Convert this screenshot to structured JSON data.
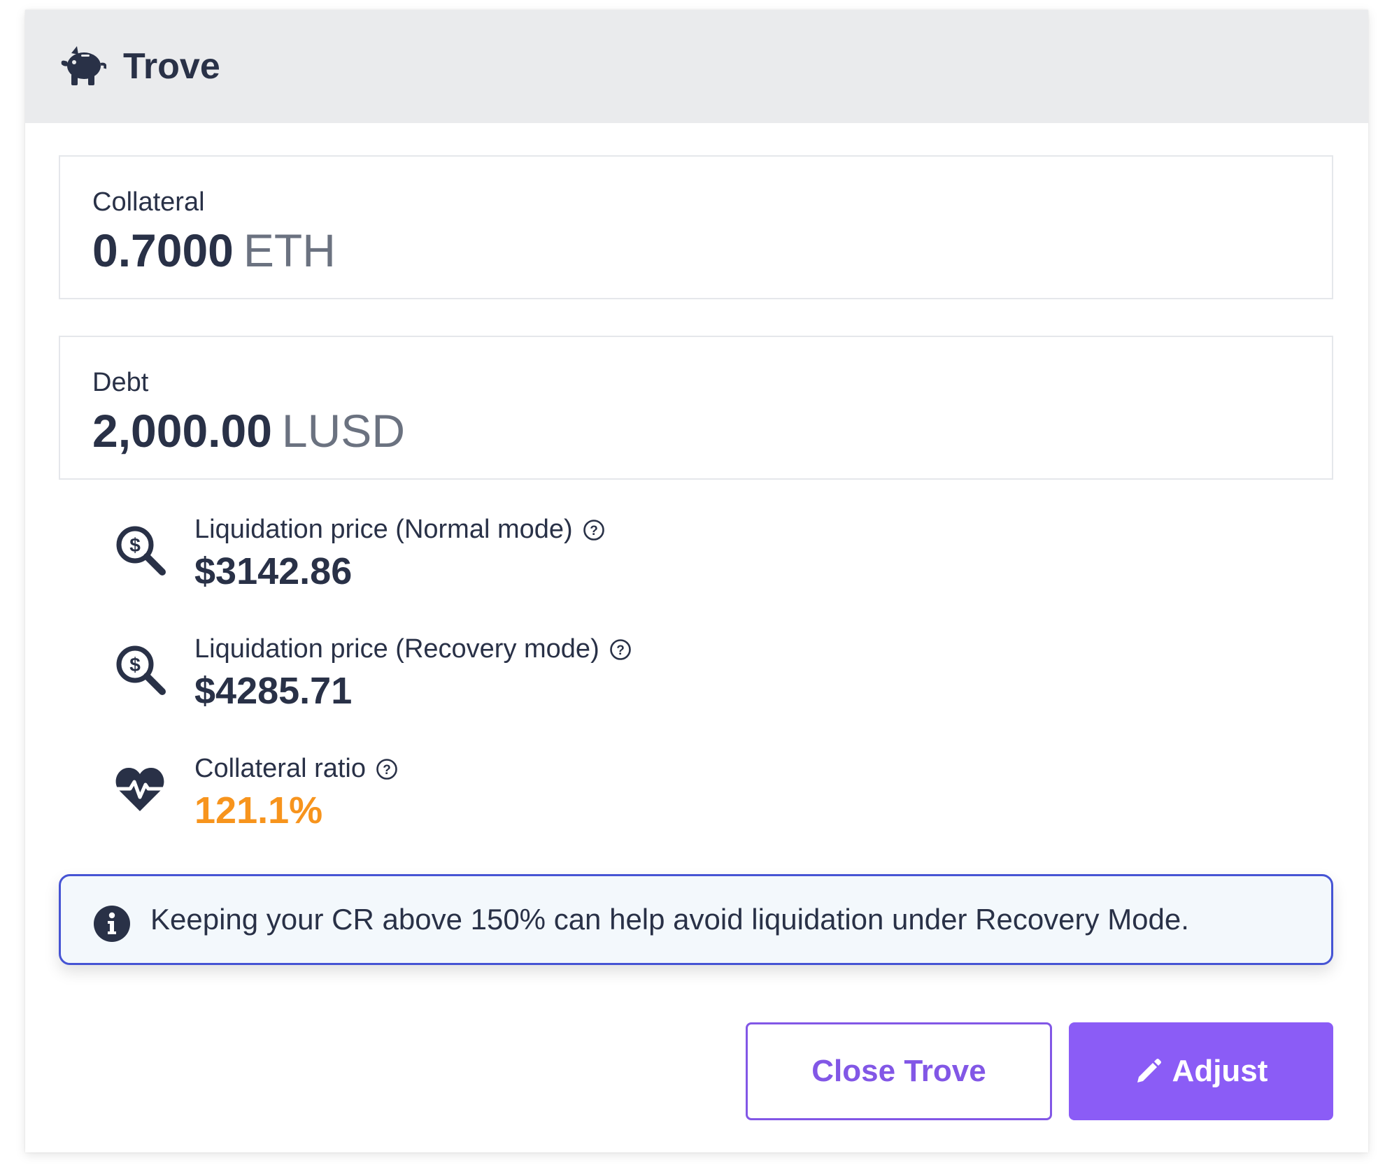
{
  "header": {
    "title": "Trove",
    "icon": "piggy-bank-icon"
  },
  "collateral": {
    "label": "Collateral",
    "amount": "0.7000",
    "unit": "ETH"
  },
  "debt": {
    "label": "Debt",
    "amount": "2,000.00",
    "unit": "LUSD"
  },
  "metrics": [
    {
      "label": "Liquidation price (Normal mode)",
      "value": "$3142.86",
      "icon": "search-dollar-icon",
      "help_icon": "question-circle-icon"
    },
    {
      "label": "Liquidation price (Recovery mode)",
      "value": "$4285.71",
      "icon": "search-dollar-icon",
      "help_icon": "question-circle-icon"
    },
    {
      "label": "Collateral ratio",
      "value": "121.1%",
      "icon": "heartbeat-icon",
      "help_icon": "question-circle-icon",
      "value_color": "#f7941d"
    }
  ],
  "info_banner": {
    "text": "Keeping your CR above 150% can help avoid liquidation under Recovery Mode.",
    "icon": "info-circle-icon"
  },
  "actions": {
    "close_label": "Close Trove",
    "adjust_label": "Adjust",
    "adjust_icon": "pencil-icon"
  },
  "colors": {
    "accent": "#8b5cf6",
    "text": "#293147",
    "warning": "#f7941d",
    "info_border": "#4654d4",
    "header_bg": "#eaebed"
  }
}
